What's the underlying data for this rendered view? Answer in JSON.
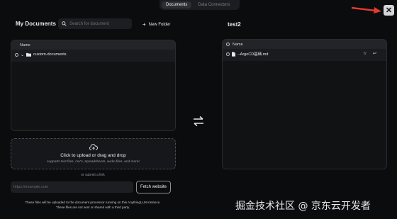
{
  "header": {
    "tabs": [
      {
        "label": "Documents",
        "active": true
      },
      {
        "label": "Data Connectors",
        "active": false
      }
    ],
    "close_icon": "close-icon",
    "arrow_color": "#e23b2e"
  },
  "left": {
    "title": "My Documents",
    "search": {
      "placeholder": "Search for document",
      "value": ""
    },
    "new_folder_label": "New Folder",
    "table": {
      "column": "Name",
      "rows": [
        {
          "name": "custom-documents",
          "type": "folder"
        }
      ]
    },
    "upload": {
      "title": "Click to upload or drag and drop",
      "subtitle": "supports text files, csv's, spreadsheets, audio files, and more!"
    },
    "or_text": "or submit a link",
    "link_input": {
      "placeholder": "https://example.com",
      "value": ""
    },
    "fetch_label": "Fetch website",
    "footnote_line1": "These files will be uploaded to the document processor running on this AnythingLLM instance.",
    "footnote_line2": "These files are not sent or shared with a third party."
  },
  "right": {
    "title": "test2",
    "table": {
      "column": "Name",
      "rows": [
        {
          "name": "--ArgoCD基础.md",
          "type": "file"
        }
      ]
    }
  },
  "watermark": "掘金技术社区 @ 京东云开发者"
}
